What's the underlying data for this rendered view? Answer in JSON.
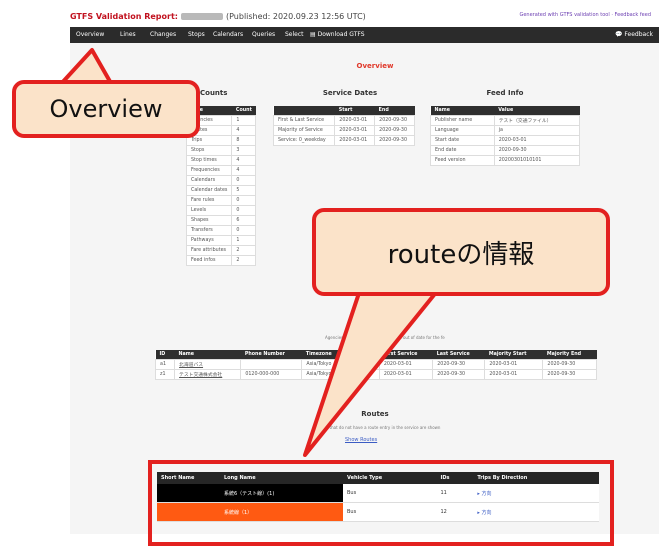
{
  "header": {
    "title_prefix": "GTFS Validation Report:",
    "published": "(Published: 2020.09.23 12:56 UTC)",
    "links": "Generated with GTFS validation tool · Feedback feed"
  },
  "nav": {
    "items": [
      "Overview",
      "Lines",
      "Changes",
      "Stops",
      "Calendars",
      "Queries",
      "Select"
    ],
    "download": "Download GTFS",
    "feedback": "Feedback"
  },
  "overview": {
    "title": "Overview"
  },
  "counts": {
    "title": "Counts",
    "headers": [
      "Type",
      "Count"
    ],
    "rows": [
      [
        "Agencies",
        "1"
      ],
      [
        "Routes",
        "4"
      ],
      [
        "Trips",
        "8"
      ],
      [
        "Stops",
        "3"
      ],
      [
        "Stop times",
        "4"
      ],
      [
        "Frequencies",
        "4"
      ],
      [
        "Calendars",
        "0"
      ],
      [
        "Calendar dates",
        "5"
      ],
      [
        "Fare rules",
        "0"
      ],
      [
        "Levels",
        "0"
      ],
      [
        "Shapes",
        "6"
      ],
      [
        "Transfers",
        "0"
      ],
      [
        "Pathways",
        "1"
      ],
      [
        "Fare attributes",
        "2"
      ],
      [
        "Feed infos",
        "2"
      ]
    ]
  },
  "service_dates": {
    "title": "Service Dates",
    "headers": [
      "",
      "Start",
      "End"
    ],
    "rows": [
      [
        "First & Last Service",
        "2020-03-01",
        "2020-09-30"
      ],
      [
        "Majority of Service",
        "2020-03-01",
        "2020-09-30"
      ],
      [
        "Service: 0_weekday",
        "2020-03-01",
        "2020-09-30"
      ]
    ]
  },
  "feed_info": {
    "title": "Feed Info",
    "headers": [
      "Name",
      "Value"
    ],
    "rows": [
      [
        "Publisher name",
        "テスト（交通ファイル）"
      ],
      [
        "Language",
        "ja"
      ],
      [
        "Start date",
        "2020-03-01"
      ],
      [
        "End date",
        "2020-09-30"
      ],
      [
        "Feed version",
        "20200301010101"
      ]
    ]
  },
  "agencies": {
    "note": "Agencies with service periods that are out of date for the feed are shown in red.",
    "headers": [
      "ID",
      "Name",
      "Phone Number",
      "Timezone",
      "Details",
      "First Service",
      "Last Service",
      "Majority Start",
      "Majority End"
    ],
    "rows": [
      [
        "a1",
        "北海道バス",
        "",
        "Asia/Tokyo",
        "Routes",
        "2020-03-01",
        "2020-09-30",
        "2020-03-01",
        "2020-09-30"
      ],
      [
        "z1",
        "テスト交通株式会社",
        "0120-000-000",
        "Asia/Tokyo",
        "Routes",
        "2020-03-01",
        "2020-09-30",
        "2020-03-01",
        "2020-09-30"
      ]
    ]
  },
  "routes_section": {
    "title": "Routes",
    "note": "Routes that do not have a route entry in the service are shown",
    "link": "Show Routes",
    "headers": [
      "Short Name",
      "Long Name",
      "Vehicle Type",
      "IDs",
      "Trips By Direction"
    ],
    "rows": [
      {
        "short": "",
        "long": "系統6（テスト線）(1)",
        "vehicle": "Bus",
        "ids": "11",
        "dir": "▸ 方向",
        "color": "#000000"
      },
      {
        "short": "",
        "long": "系統線（1）",
        "vehicle": "Bus",
        "ids": "12",
        "dir": "▸ 方向",
        "color": "#ff5a12"
      }
    ]
  },
  "annotations": {
    "overview_callout": "Overview",
    "route_callout": "routeの情報"
  },
  "colors": {
    "accent_red": "#e3211f",
    "callout_fill": "#fbe3c9",
    "nav_bg": "#2b2b2b",
    "route_black": "#000000",
    "route_orange": "#ff5a12"
  }
}
